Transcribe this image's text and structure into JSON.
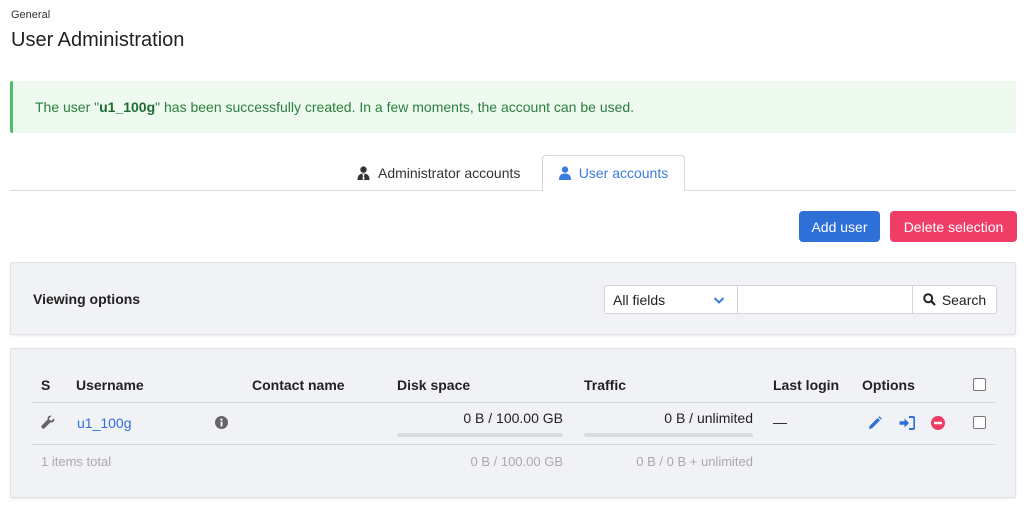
{
  "breadcrumb": "General",
  "page_title": "User Administration",
  "alert": {
    "prefix": "The user \"",
    "username": "u1_100g",
    "suffix": "\" has been successfully created. In a few moments, the account can be used."
  },
  "tabs": [
    {
      "label": "Administrator accounts",
      "icon": "admin-user-icon"
    },
    {
      "label": "User accounts",
      "icon": "user-icon",
      "active": true
    }
  ],
  "actions": {
    "add_label": "Add user",
    "delete_label": "Delete selection"
  },
  "viewing": {
    "label": "Viewing options",
    "field_select": "All fields",
    "search_value": "",
    "search_label": "Search"
  },
  "table": {
    "headers": {
      "s": "S",
      "username": "Username",
      "contact": "Contact name",
      "disk": "Disk space",
      "traffic": "Traffic",
      "last_login": "Last login",
      "options": "Options"
    },
    "rows": [
      {
        "username": "u1_100g",
        "contact": "",
        "disk": "0 B / 100.00 GB",
        "traffic": "0 B / unlimited",
        "last_login": "—"
      }
    ],
    "footer": {
      "total": "1 items total",
      "disk": "0 B / 100.00 GB",
      "traffic": "0 B / 0 B + unlimited"
    }
  },
  "colors": {
    "primary": "#2f6fd8",
    "danger": "#f03d67",
    "success": "#4cbf68"
  }
}
